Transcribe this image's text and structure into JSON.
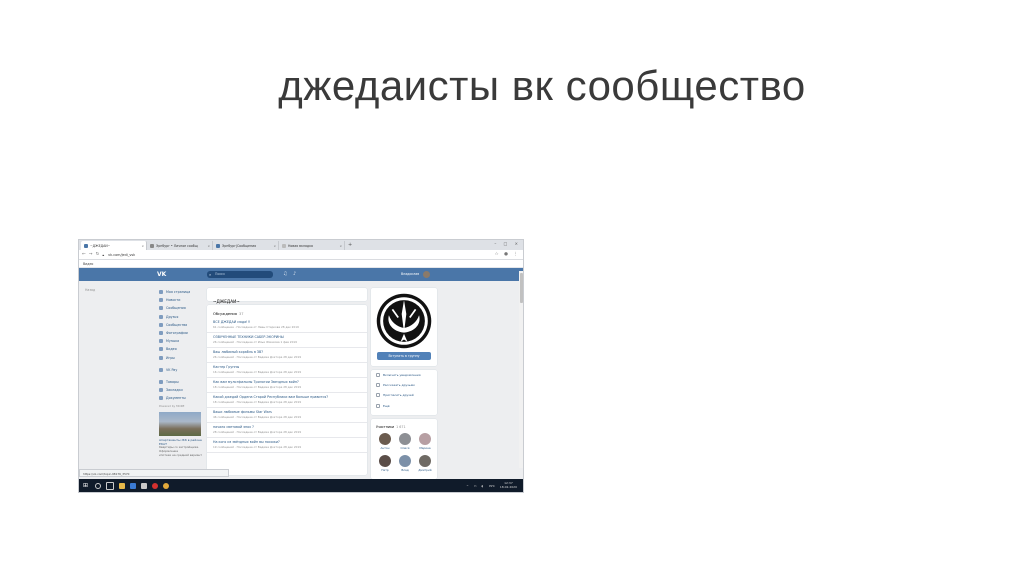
{
  "slide": {
    "title": "джедаисты вк сообщество"
  },
  "browser": {
    "tabs": [
      {
        "label": "~ДЖЕДАИ~",
        "active": true
      },
      {
        "label": "Эрнбург • Личное сообщ",
        "active": false
      },
      {
        "label": "Эрнбург|Сообщения",
        "active": false
      },
      {
        "label": "Новая вкладка",
        "active": false
      }
    ],
    "new_tab": "+",
    "window_controls": "– □ ×",
    "url": "vk.com/jedi_vsk",
    "bookmarks_label": "Видео"
  },
  "vk": {
    "logo": "VK",
    "search_placeholder": "Поиск",
    "user_name": "Владислав",
    "back_link": "Назад",
    "nav": [
      "Моя страница",
      "Новости",
      "Сообщения",
      "Друзья",
      "Сообщества",
      "Фотографии",
      "Музыка",
      "Видео",
      "Игры"
    ],
    "nav2": [
      "VK Pay"
    ],
    "nav3": [
      "Товары",
      "Закладки",
      "Документы"
    ],
    "powered": "Powered by MORE",
    "ad": {
      "title": "Апартаменты ЖК в районе ЕКАТ",
      "desc": "Квартиры со застройщика. Оформление",
      "desc2": "ипотеки на средний вариант"
    },
    "community_title": "~ДЖЕДАИ~",
    "discussions": {
      "header": "Обсуждения",
      "count": "37",
      "topics": [
        {
          "title": "ВСЕ ДЖЕДАИ сюда!!!",
          "meta": "61 сообщение · Последнее от Левы Старкова 28 дек 2019"
        },
        {
          "title": "ОЗВУЧЕННЫЕ ТЕХНИКИ САБЕР-ЭКОРИНЫ",
          "meta": "26 сообщений · Последнее от Ильи Жмахова 1 фев 2019"
        },
        {
          "title": "Ваш любимый корабль в ЗВ?",
          "meta": "26 сообщений · Последнее от Вадима Доктора 28 дек 2019"
        },
        {
          "title": "Кастер Группы",
          "meta": "16 сообщений · Последнее от Вадима Доктора 28 дек 2019"
        },
        {
          "title": "Как вам мультфильмы Трилогии Звездных войн?",
          "meta": "18 сообщений · Последнее от Вадима Доктора 28 дек 2019"
        },
        {
          "title": "Какой джедай Ордена Старой Республики вам больше нравится?",
          "meta": "18 сообщений · Последнее от Вадима Доктора 28 дек 2019"
        },
        {
          "title": "Ваши любимые фильмы Star Wars",
          "meta": "46 сообщений · Последнее от Вадима Доктора 28 дек 2019"
        },
        {
          "title": "начало световой эпох ?",
          "meta": "28 сообщений · Последнее от Вадима Доктора 28 дек 2019"
        },
        {
          "title": "На кого из звёздных войн вы похожи?",
          "meta": "19 сообщений · Последнее от Вадима Доктора 28 дек 2019"
        }
      ]
    },
    "join_button": "Вступить в группу",
    "actions": [
      "Включить уведомления",
      "Рассказать друзьям",
      "Пригласить друзей",
      "Ещё"
    ],
    "members": {
      "header": "Участники",
      "count": "1 671",
      "people": [
        "Антон",
        "Олеся",
        "Марина",
        "Петр",
        "Влад",
        "Дмитрий"
      ]
    },
    "status_url": "https://vk.com/topic-98176_3570",
    "scroll_top": "▲"
  },
  "taskbar": {
    "lang": "РУС",
    "time": "12:37",
    "date": "18.02.2020"
  },
  "colors": {
    "vk_blue": "#4a76a8",
    "link": "#2a5885",
    "button": "#5181b8",
    "taskbar": "#101b2a"
  }
}
